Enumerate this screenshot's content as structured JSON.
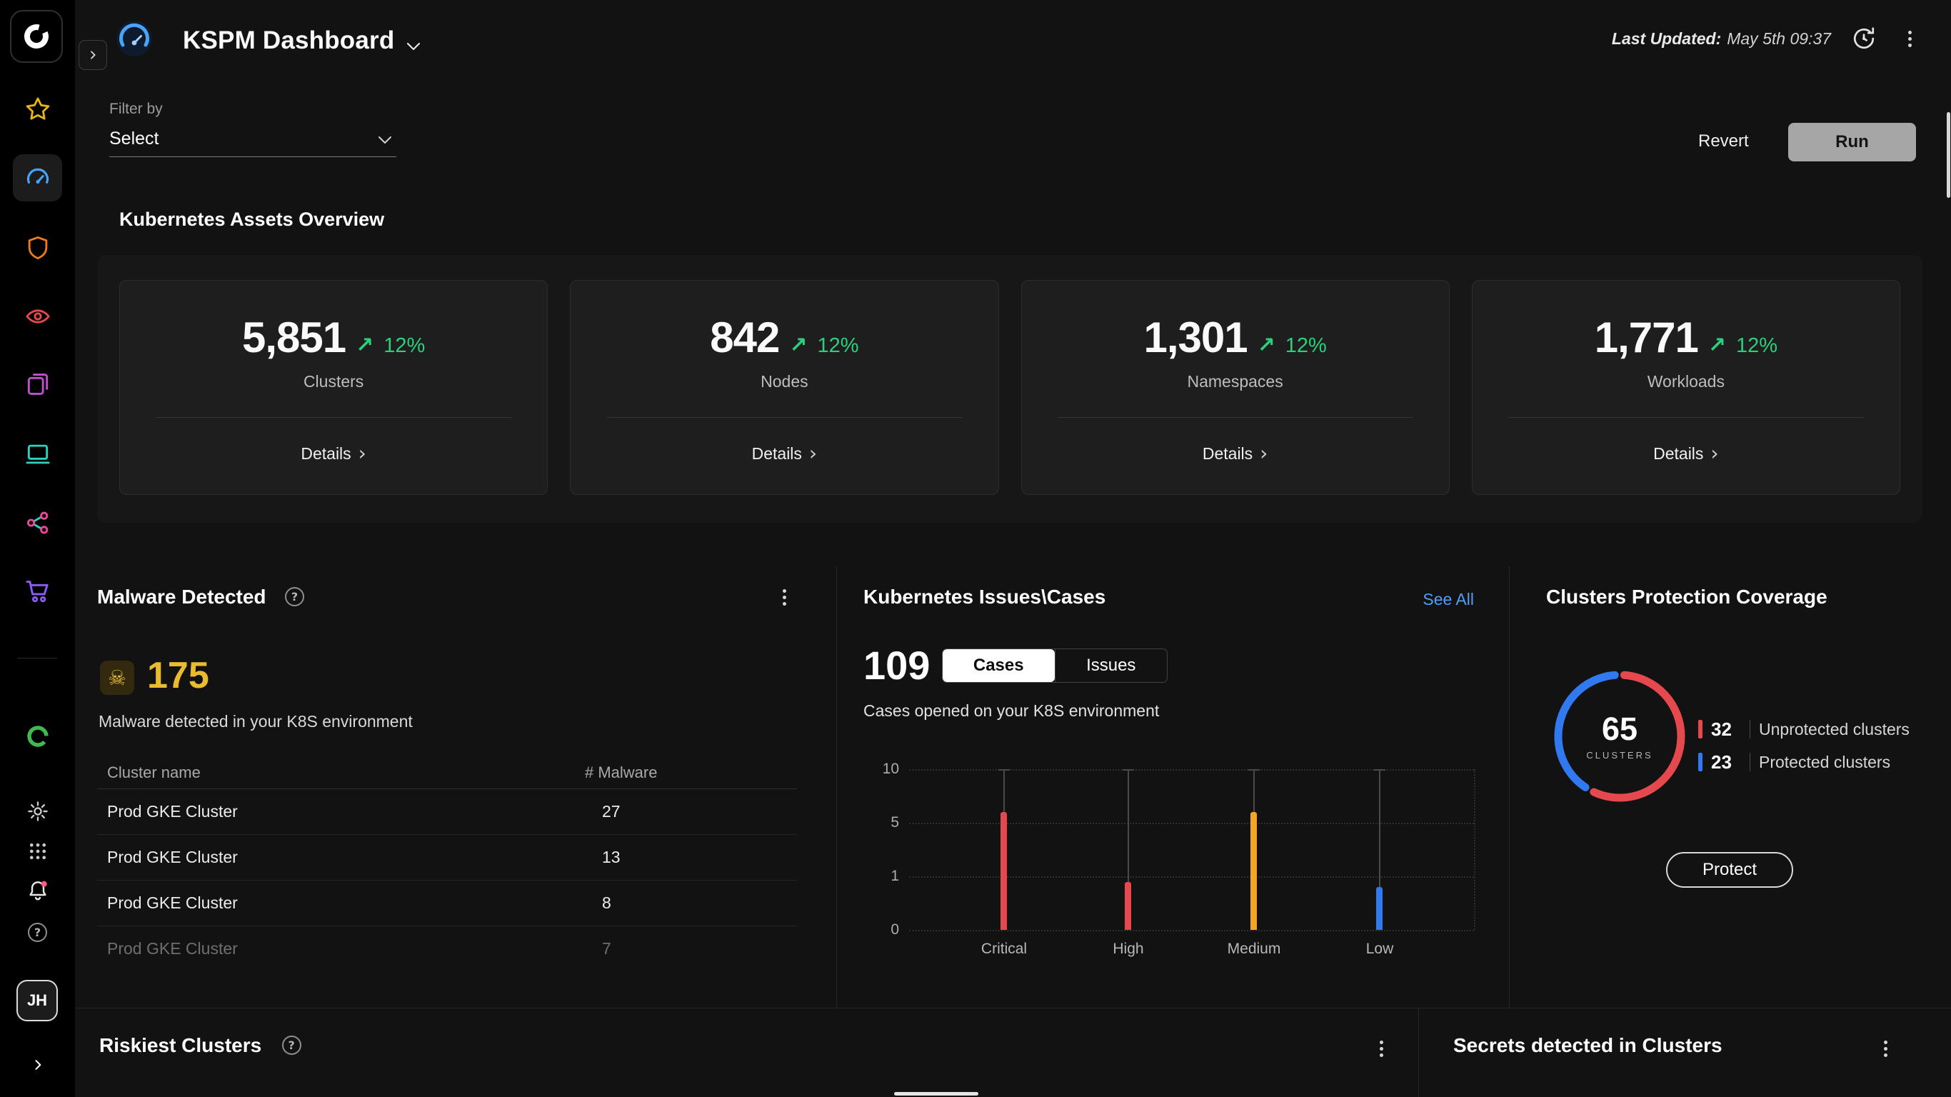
{
  "icons": {
    "trend_up": "↗",
    "chevron_right": "›",
    "skull": "☠",
    "question": "?"
  },
  "sidebar": {
    "avatar_initials": "JH",
    "items": [
      "star",
      "gauge",
      "shield",
      "eye",
      "pages",
      "laptop",
      "share",
      "cart"
    ],
    "footer_items": [
      "ring",
      "gear",
      "grid",
      "bell",
      "help"
    ]
  },
  "header": {
    "title": "KSPM Dashboard",
    "last_updated_label": "Last Updated:",
    "last_updated_value": "May 5th 09:37"
  },
  "filter": {
    "label": "Filter by",
    "value": "Select"
  },
  "actions": {
    "revert": "Revert",
    "run": "Run"
  },
  "assets": {
    "heading": "Kubernetes Assets Overview",
    "details_label": "Details",
    "cards": [
      {
        "value": "5,851",
        "delta": "12%",
        "label": "Clusters"
      },
      {
        "value": "842",
        "delta": "12%",
        "label": "Nodes"
      },
      {
        "value": "1,301",
        "delta": "12%",
        "label": "Namespaces"
      },
      {
        "value": "1,771",
        "delta": "12%",
        "label": "Workloads"
      }
    ]
  },
  "malware": {
    "title": "Malware Detected",
    "count": "175",
    "subtitle": "Malware detected in your K8S environment",
    "columns": [
      "Cluster name",
      "# Malware"
    ],
    "rows": [
      {
        "name": "Prod GKE Cluster",
        "count": "27"
      },
      {
        "name": "Prod GKE Cluster",
        "count": "13"
      },
      {
        "name": "Prod GKE Cluster",
        "count": "8"
      },
      {
        "name": "Prod GKE Cluster",
        "count": "7"
      }
    ]
  },
  "issues": {
    "title": "Kubernetes Issues\\Cases",
    "see_all": "See All",
    "count": "109",
    "tabs": [
      {
        "label": "Cases",
        "selected": true
      },
      {
        "label": "Issues",
        "selected": false
      }
    ],
    "subtitle": "Cases opened on your K8S environment",
    "chart_data": {
      "type": "bar",
      "categories": [
        "Critical",
        "High",
        "Medium",
        "Low"
      ],
      "values": [
        6,
        0.9,
        6,
        0.8
      ],
      "colors": [
        "#e5484d",
        "#e5484d",
        "#f5a524",
        "#3179f0"
      ],
      "yticks": [
        10,
        5,
        1,
        0
      ],
      "whisker_max": 10
    }
  },
  "coverage": {
    "title": "Clusters Protection Coverage",
    "center_value": "65",
    "center_label": "CLUSTERS",
    "legend": [
      {
        "value": "32",
        "label": "Unprotected clusters",
        "color": "#e5484d"
      },
      {
        "value": "23",
        "label": "Protected clusters",
        "color": "#3179f0"
      }
    ],
    "protect_label": "Protect"
  },
  "bottom": {
    "riskiest_title": "Riskiest Clusters",
    "secrets_title": "Secrets detected in Clusters"
  }
}
